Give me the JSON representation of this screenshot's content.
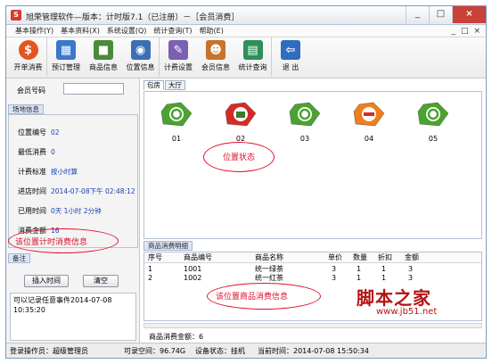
{
  "window": {
    "title": "旭荣管理软件—版本：计时版7.1（已注册）－［会员消费］",
    "app_icon_glyph": "S",
    "controls": [
      "_",
      "□",
      "×"
    ],
    "mdi_controls": [
      "_",
      "□",
      "×"
    ]
  },
  "menu": [
    "基本操作(Y)",
    "基本资料(X)",
    "系统设置(Q)",
    "统计查询(T)",
    "帮助(E)"
  ],
  "toolbar": [
    {
      "label": "开单消费",
      "icon": "coin-icon",
      "color": "#e8541f"
    },
    {
      "label": "预订管理",
      "icon": "calendar-icon",
      "color": "#3b78c9"
    },
    {
      "label": "商品信息",
      "icon": "product-icon",
      "color": "#4b8a3a"
    },
    {
      "label": "位置信息",
      "icon": "location-icon",
      "color": "#3a6fb6"
    },
    {
      "label": "计费设置",
      "icon": "billing-icon",
      "color": "#7b5fb0"
    },
    {
      "label": "会员信息",
      "icon": "member-icon",
      "color": "#c9722b"
    },
    {
      "label": "统计查询",
      "icon": "stats-icon",
      "color": "#2d8f5a"
    },
    {
      "label": "退 出",
      "icon": "exit-icon",
      "color": "#2f6dbf"
    }
  ],
  "left_panel": {
    "member_no_label": "会员号码",
    "member_no_value": "",
    "section_title": "场地信息",
    "rows": [
      {
        "label": "位置编号",
        "value": "02"
      },
      {
        "label": "最低消费",
        "value": "0"
      },
      {
        "label": "计费标准",
        "value": "按小时算"
      },
      {
        "label": "进店时间",
        "value": "2014-07-08下午 02:48:12"
      },
      {
        "label": "已用时间",
        "value": "0天 1小时 2分钟"
      },
      {
        "label": "消费金额",
        "value": "16"
      }
    ],
    "annotation": "该位置计时消费信息",
    "notes_title": "备注",
    "insert_time_button": "插入时间",
    "clear_button": "清空",
    "notes_text": "可以记录任意事件2014-07-08 10:35:20"
  },
  "right_panel": {
    "tabs": [
      "包房",
      "大厅"
    ],
    "seats": [
      {
        "num": "01",
        "status": "free",
        "color": "#4aa32e"
      },
      {
        "num": "02",
        "status": "occupied",
        "color": "#d52b26"
      },
      {
        "num": "03",
        "status": "free",
        "color": "#4aa32e"
      },
      {
        "num": "04",
        "status": "disabled",
        "color": "#ef7f1a"
      },
      {
        "num": "05",
        "status": "free",
        "color": "#4aa32e"
      }
    ],
    "status_annotation": "位置状态",
    "goods_title": "商品消费明细",
    "goods_columns": [
      "序号",
      "商品编号",
      "商品名称",
      "单价",
      "数量",
      "折扣",
      "金额"
    ],
    "goods_rows": [
      [
        "1",
        "1001",
        "统一绿茶",
        "3",
        "1",
        "1",
        "3"
      ],
      [
        "2",
        "1002",
        "统一红茶",
        "3",
        "1",
        "1",
        "3"
      ]
    ],
    "goods_annotation": "该位置商品消费信息",
    "goods_total_label": "商品消费金额：",
    "goods_total_value": "6"
  },
  "status_bar": {
    "operator": "登录操作员：超级管理员",
    "space": "可录空间：96.74G",
    "device": "设备状态：挂机",
    "time": "当前时间：2014-07-08 15:50:34"
  },
  "watermark": {
    "line1": "脚本之家",
    "line2": "www.jb51.net"
  }
}
